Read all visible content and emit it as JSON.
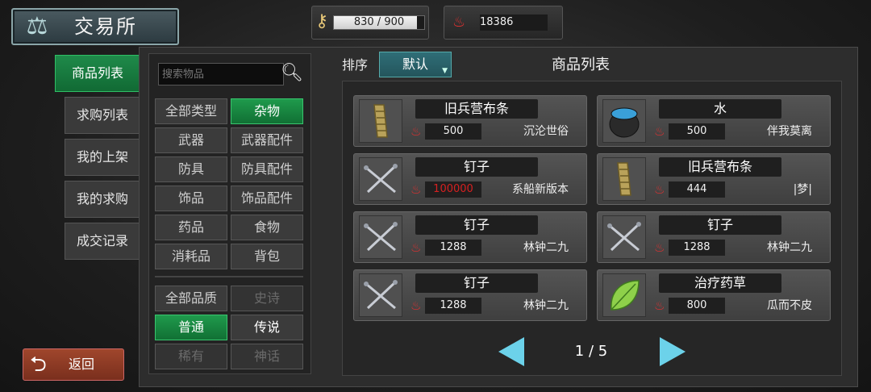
{
  "header": {
    "title": "交易所",
    "resource1": {
      "current": "830 / 900",
      "fill": 0.922
    },
    "resource2": {
      "value": "18386"
    }
  },
  "left_tabs": [
    "商品列表",
    "求购列表",
    "我的上架",
    "我的求购",
    "成交记录"
  ],
  "back_label": "返回",
  "search": {
    "placeholder": "搜索物品"
  },
  "type_filters": [
    [
      "全部类型",
      "杂物"
    ],
    [
      "武器",
      "武器配件"
    ],
    [
      "防具",
      "防具配件"
    ],
    [
      "饰品",
      "饰品配件"
    ],
    [
      "药品",
      "食物"
    ],
    [
      "消耗品",
      "背包"
    ]
  ],
  "quality_filters": [
    [
      "全部品质",
      "史诗"
    ],
    [
      "普通",
      "传说"
    ],
    [
      "稀有",
      "神话"
    ]
  ],
  "sort": {
    "label": "排序",
    "selected": "默认"
  },
  "list_title": "商品列表",
  "items": [
    {
      "name": "旧兵营布条",
      "price": "500",
      "seller": "沉沦世俗",
      "icon": "cloth-strip-icon",
      "price_red": false
    },
    {
      "name": "水",
      "price": "500",
      "seller": "伴我莫离",
      "icon": "water-pot-icon",
      "price_red": false
    },
    {
      "name": "钉子",
      "price": "100000",
      "seller": "系船新版本",
      "icon": "nails-icon",
      "price_red": true
    },
    {
      "name": "旧兵营布条",
      "price": "444",
      "seller": "|梦|",
      "icon": "cloth-strip-icon",
      "price_red": false
    },
    {
      "name": "钉子",
      "price": "1288",
      "seller": "林钟二九",
      "icon": "nails-icon",
      "price_red": false
    },
    {
      "name": "钉子",
      "price": "1288",
      "seller": "林钟二九",
      "icon": "nails-icon",
      "price_red": false
    },
    {
      "name": "钉子",
      "price": "1288",
      "seller": "林钟二九",
      "icon": "nails-icon",
      "price_red": false
    },
    {
      "name": "治疗药草",
      "price": "800",
      "seller": "瓜而不皮",
      "icon": "herb-leaf-icon",
      "price_red": false
    }
  ],
  "pager": {
    "text": "1 / 5"
  },
  "colors": {
    "accent_green": "#1f8a4a",
    "pager_arrow": "#6cd2ea",
    "price_red": "#d62020"
  }
}
